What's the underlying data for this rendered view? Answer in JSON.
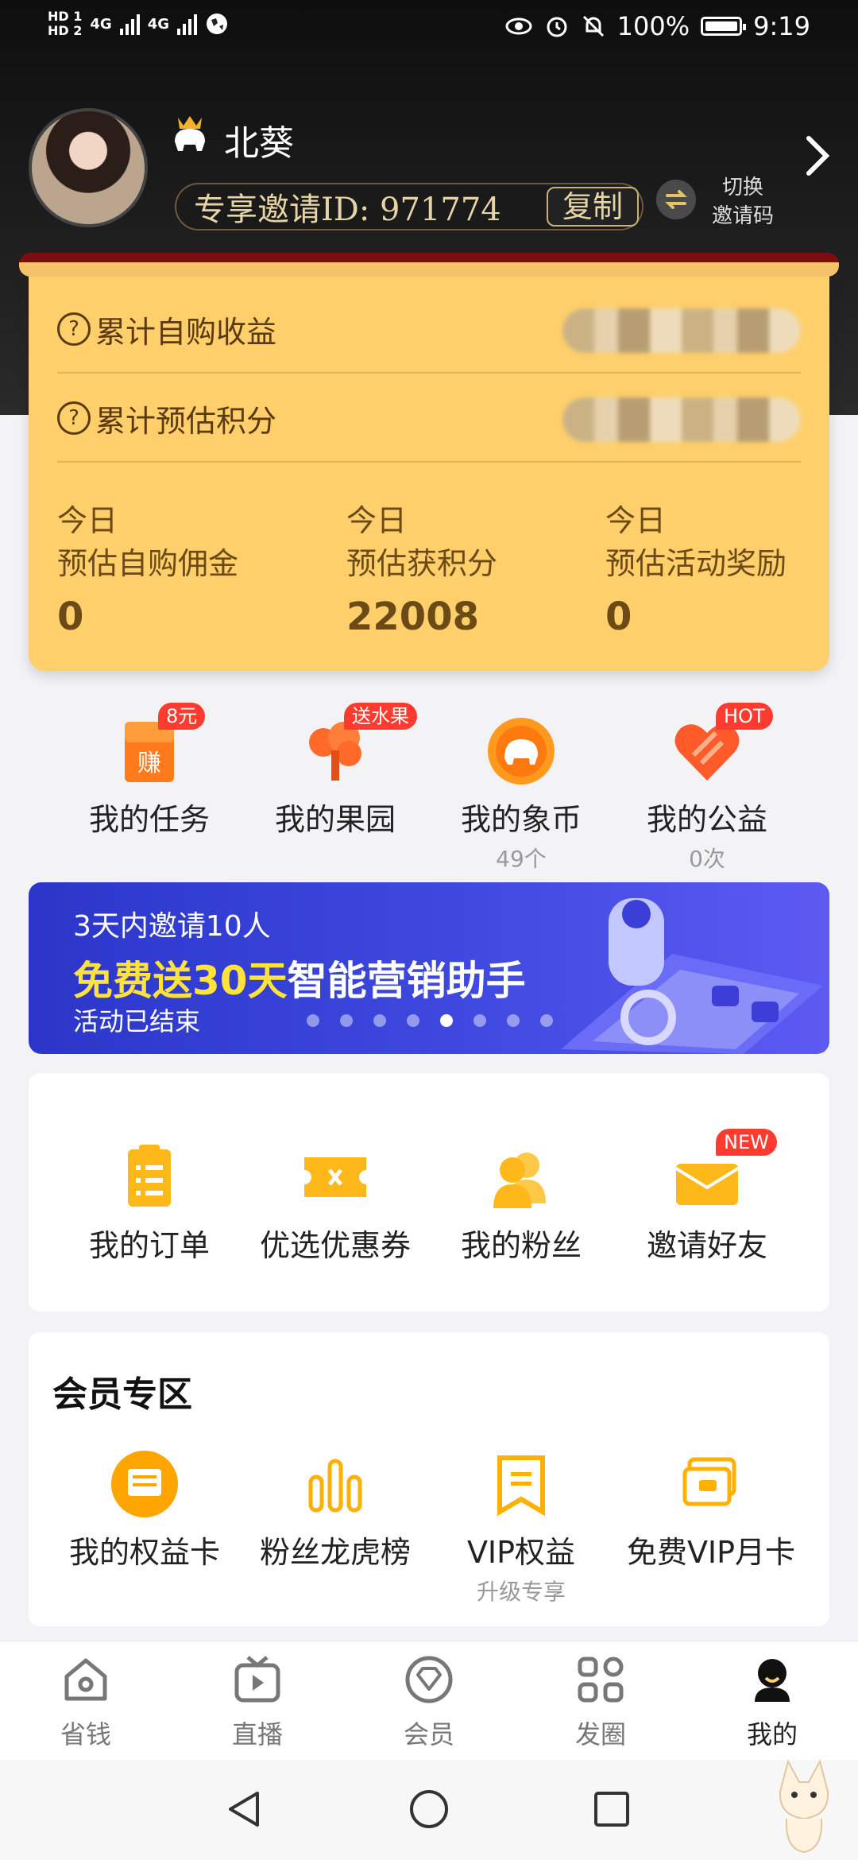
{
  "status_bar": {
    "hd1": "HD 1",
    "hd2": "HD 2",
    "net1": "4G",
    "net2": "4G",
    "battery": "100%",
    "time": "9:19"
  },
  "profile": {
    "username": "北葵",
    "invite_text": "专享邀请ID: 971774",
    "copy_label": "复制",
    "switch_label_line1": "切换",
    "switch_label_line2": "邀请码"
  },
  "earnings": {
    "row1_label": "累计自购收益",
    "row2_label": "累计预估积分",
    "today": [
      {
        "line1": "今日",
        "line2": "预估自购佣金",
        "value": "0"
      },
      {
        "line1": "今日",
        "line2": "预估获积分",
        "value": "22008"
      },
      {
        "line1": "今日",
        "line2": "预估活动奖励",
        "value": "0"
      }
    ]
  },
  "quick_row1": [
    {
      "label": "我的任务",
      "badge": "8元",
      "sub": ""
    },
    {
      "label": "我的果园",
      "badge": "送水果",
      "sub": ""
    },
    {
      "label": "我的象币",
      "badge": "",
      "sub": "49个"
    },
    {
      "label": "我的公益",
      "badge": "HOT",
      "sub": "0次"
    }
  ],
  "banner": {
    "line1": "3天内邀请10人",
    "line2_a": "免费送",
    "line2_b": "30天",
    "line2_c": "智能营销助手",
    "line3": "活动已结束"
  },
  "quick_row2": [
    {
      "label": "我的订单",
      "badge": ""
    },
    {
      "label": "优选优惠券",
      "badge": ""
    },
    {
      "label": "我的粉丝",
      "badge": ""
    },
    {
      "label": "邀请好友",
      "badge": "NEW"
    }
  ],
  "member": {
    "title": "会员专区",
    "items": [
      {
        "label": "我的权益卡",
        "sub": ""
      },
      {
        "label": "粉丝龙虎榜",
        "sub": ""
      },
      {
        "label": "VIP权益",
        "sub": "升级专享"
      },
      {
        "label": "免费VIP月卡",
        "sub": ""
      }
    ]
  },
  "bottom_nav": [
    {
      "label": "省钱",
      "icon": "home-icon"
    },
    {
      "label": "直播",
      "icon": "tv-icon"
    },
    {
      "label": "会员",
      "icon": "diamond-icon"
    },
    {
      "label": "发圈",
      "icon": "grid-icon"
    },
    {
      "label": "我的",
      "icon": "profile-icon"
    }
  ],
  "colors": {
    "accent": "#ffcf6b",
    "icon_orange": "#ff9f1a",
    "badge_red": "#ff3b2f",
    "banner_blue": "#3f49e0"
  }
}
